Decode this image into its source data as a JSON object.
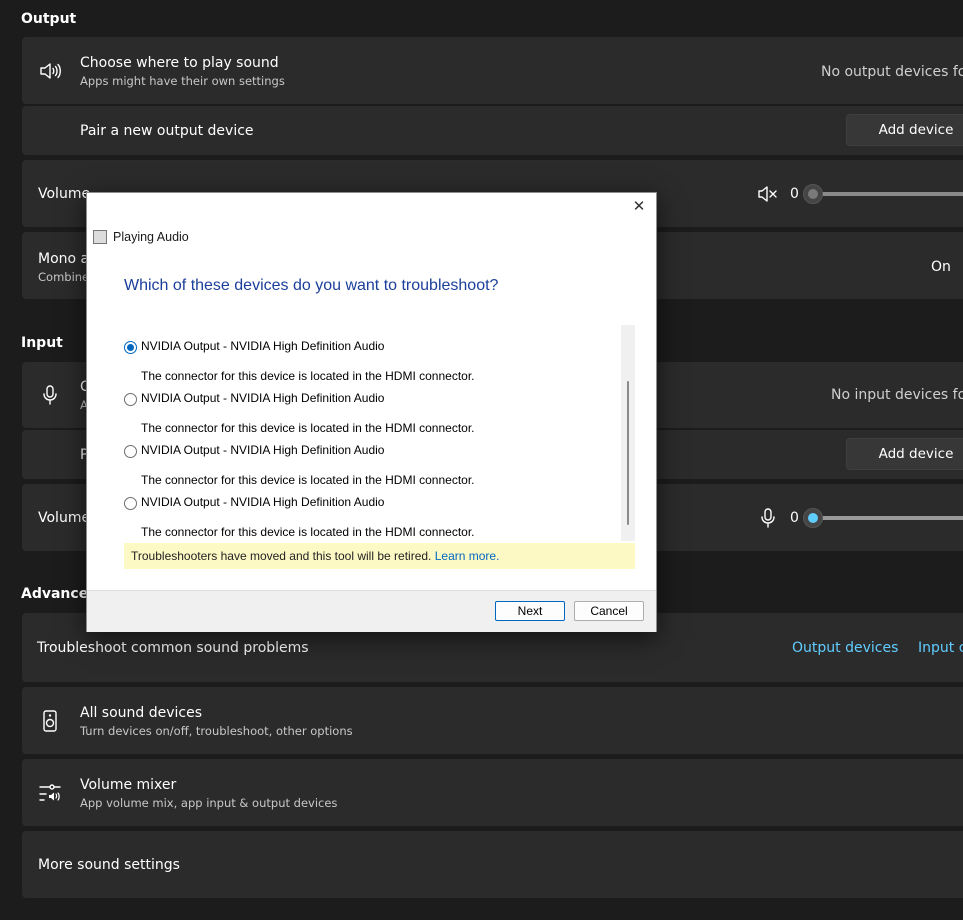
{
  "output": {
    "section_label": "Output",
    "choose": {
      "title": "Choose where to play sound",
      "subtitle": "Apps might have their own settings",
      "status": "No output devices four"
    },
    "pair": {
      "title": "Pair a new output device",
      "button": "Add device"
    },
    "volume": {
      "label": "Volume",
      "value": "0",
      "level": 0
    },
    "mono": {
      "title": "Mono a",
      "subtitle": "Combine",
      "state": "On"
    }
  },
  "input": {
    "section_label": "Input",
    "choose": {
      "title": "C",
      "subtitle": "A",
      "status": "No input devices four"
    },
    "pair": {
      "title": "P",
      "button": "Add device"
    },
    "volume": {
      "label": "Volume",
      "value": "0",
      "level": 0
    }
  },
  "advanced": {
    "section_label": "Advanced",
    "troubleshoot": {
      "title": "Troubleshoot common sound problems",
      "output_link": "Output devices",
      "input_link": "Input c"
    },
    "all_devices": {
      "title": "All sound devices",
      "subtitle": "Turn devices on/off, troubleshoot, other options"
    },
    "mixer": {
      "title": "Volume mixer",
      "subtitle": "App volume mix, app input & output devices"
    },
    "more": {
      "title": "More sound settings"
    }
  },
  "dialog": {
    "app_title": "Playing Audio",
    "heading": "Which of these devices do you want to troubleshoot?",
    "devices": [
      {
        "name": "NVIDIA Output - NVIDIA High Definition Audio",
        "desc": "The connector for this device is located in the HDMI connector.",
        "selected": true
      },
      {
        "name": "NVIDIA Output - NVIDIA High Definition Audio",
        "desc": "The connector for this device is located in the HDMI connector.",
        "selected": false
      },
      {
        "name": "NVIDIA Output - NVIDIA High Definition Audio",
        "desc": "The connector for this device is located in the HDMI connector.",
        "selected": false
      },
      {
        "name": "NVIDIA Output - NVIDIA High Definition Audio",
        "desc": "The connector for this device is located in the HDMI connector.",
        "selected": false
      }
    ],
    "notice_text": "Troubleshooters have moved and this tool will be retired.",
    "notice_link": "Learn more.",
    "next_label": "Next",
    "cancel_label": "Cancel",
    "close_glyph": "✕"
  },
  "colors": {
    "accent": "#60cdff",
    "dialog_heading": "#1b3f9b",
    "notice_bg": "#fdf9c5"
  }
}
